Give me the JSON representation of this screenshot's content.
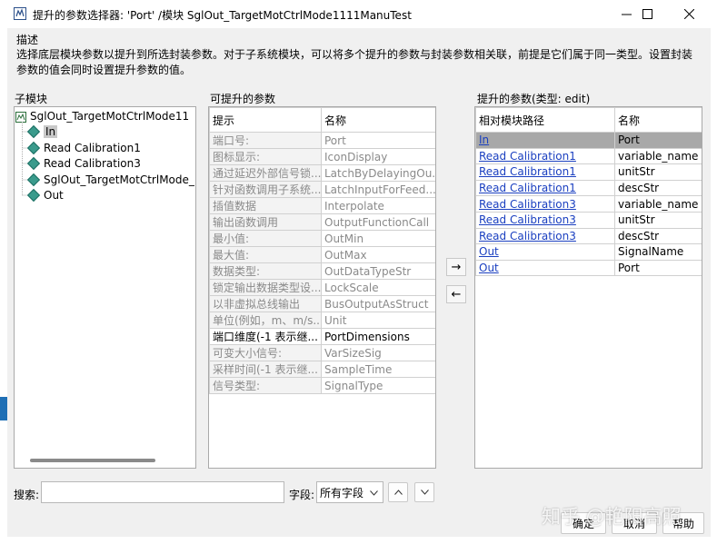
{
  "window": {
    "title": "提升的参数选择器: 'Port' /模块 SglOut_TargetMotCtrlMode1111ManuTest"
  },
  "description": {
    "label": "描述",
    "text": "选择底层模块参数以提升到所选封装参数。对于子系统模块，可以将多个提升的参数与封装参数相关联，前提是它们属于同一类型。设置封装参数的值会同时设置提升参数的值。"
  },
  "submodules": {
    "label": "子模块",
    "root": "SglOut_TargetMotCtrlMode11",
    "items": [
      "In",
      "Read Calibration1",
      "Read Calibration3",
      "SglOut_TargetMotCtrlMode_",
      "Out"
    ]
  },
  "promotable": {
    "label": "可提升的参数",
    "headers": [
      "提示",
      "名称"
    ],
    "rows": [
      {
        "hint": "端口号:",
        "name": "Port",
        "enabled": false
      },
      {
        "hint": "图标显示:",
        "name": "IconDisplay",
        "enabled": false
      },
      {
        "hint": "通过延迟外部信号锁...",
        "name": "LatchByDelayingOu...",
        "enabled": false
      },
      {
        "hint": "针对函数调用子系统...",
        "name": "LatchInputForFeed...",
        "enabled": false
      },
      {
        "hint": "插值数据",
        "name": "Interpolate",
        "enabled": false
      },
      {
        "hint": "输出函数调用",
        "name": "OutputFunctionCall",
        "enabled": false
      },
      {
        "hint": "最小值:",
        "name": "OutMin",
        "enabled": false
      },
      {
        "hint": "最大值:",
        "name": "OutMax",
        "enabled": false
      },
      {
        "hint": "数据类型:",
        "name": "OutDataTypeStr",
        "enabled": false
      },
      {
        "hint": "锁定输出数据类型设...",
        "name": "LockScale",
        "enabled": false
      },
      {
        "hint": "以非虚拟总线输出",
        "name": "BusOutputAsStruct",
        "enabled": false
      },
      {
        "hint": "单位(例如，m、m/s...",
        "name": "Unit",
        "enabled": false
      },
      {
        "hint": "端口维度(-1 表示继...",
        "name": "PortDimensions",
        "enabled": true
      },
      {
        "hint": "可变大小信号:",
        "name": "VarSizeSig",
        "enabled": false
      },
      {
        "hint": "采样时间(-1 表示继...",
        "name": "SampleTime",
        "enabled": false
      },
      {
        "hint": "信号类型:",
        "name": "SignalType",
        "enabled": false
      }
    ]
  },
  "promoted": {
    "label": "提升的参数(类型: edit)",
    "headers": [
      "相对模块路径",
      "名称"
    ],
    "rows": [
      {
        "path": "In",
        "name": "Port",
        "selected": true
      },
      {
        "path": "Read Calibration1",
        "name": "variable_name",
        "selected": false
      },
      {
        "path": "Read Calibration1",
        "name": "unitStr",
        "selected": false
      },
      {
        "path": "Read Calibration1",
        "name": "descStr",
        "selected": false
      },
      {
        "path": "Read Calibration3",
        "name": "variable_name",
        "selected": false
      },
      {
        "path": "Read Calibration3",
        "name": "unitStr",
        "selected": false
      },
      {
        "path": "Read Calibration3",
        "name": "descStr",
        "selected": false
      },
      {
        "path": "Out",
        "name": "SignalName",
        "selected": false
      },
      {
        "path": "Out",
        "name": "Port",
        "selected": false
      }
    ]
  },
  "transfer": {
    "add": "→",
    "remove": "←"
  },
  "search": {
    "label": "搜索:",
    "value": "",
    "field_label": "字段:",
    "field_value": "所有字段"
  },
  "buttons": {
    "ok": "确定",
    "cancel": "取消",
    "help": "帮助"
  },
  "watermark": "知乎 @艳阳高照"
}
